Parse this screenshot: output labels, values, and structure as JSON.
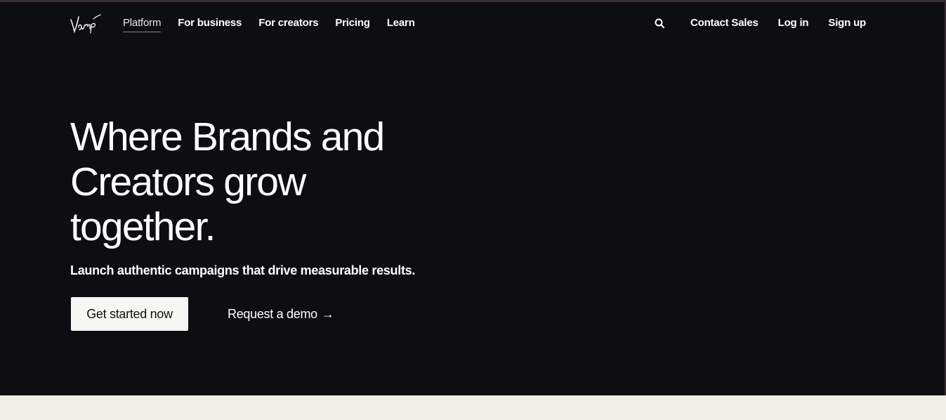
{
  "brand": {
    "logo_text": "Vamp"
  },
  "nav": {
    "links": [
      {
        "label": "Platform",
        "active": true
      },
      {
        "label": "For business",
        "active": false
      },
      {
        "label": "For creators",
        "active": false
      },
      {
        "label": "Pricing",
        "active": false
      },
      {
        "label": "Learn",
        "active": false
      }
    ],
    "search_icon": "search-icon",
    "contact_sales": "Contact Sales",
    "log_in": "Log in",
    "sign_up": "Sign up"
  },
  "hero": {
    "headline_line1": "Where Brands and",
    "headline_line2": "Creators grow",
    "headline_line3": "together.",
    "subhead": "Launch authentic campaigns that drive measurable results.",
    "primary_cta": "Get started now",
    "secondary_cta": "Request a demo",
    "secondary_cta_arrow": "→"
  },
  "colors": {
    "hero_background": "#0d0d12",
    "bottom_band": "#f0ede6",
    "primary_button_bg": "#f6f6f4",
    "text": "#ffffff"
  }
}
